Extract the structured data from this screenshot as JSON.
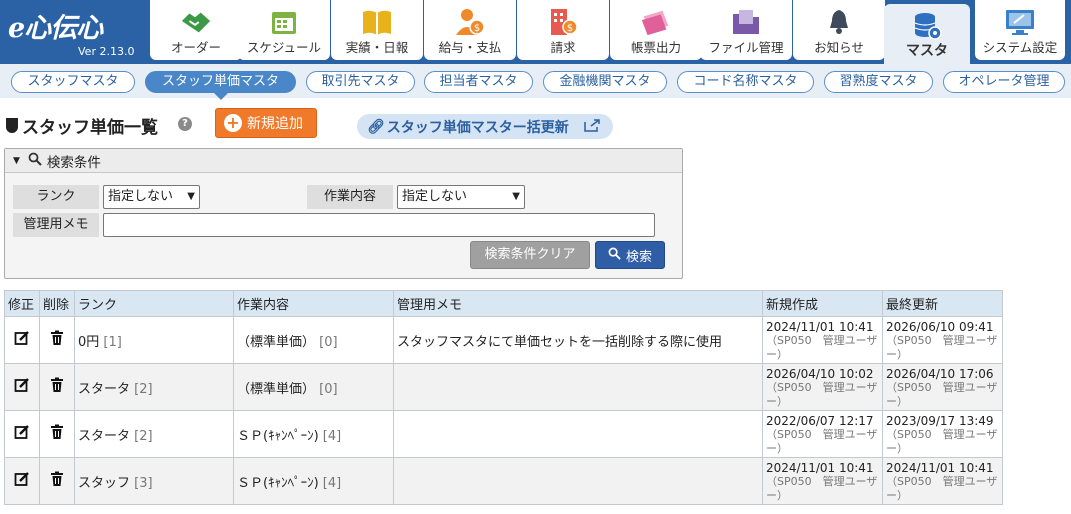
{
  "app": {
    "logo": "e心伝心",
    "version": "Ver 2.13.0"
  },
  "nav": [
    {
      "label": "オーダー",
      "icon": "handshake-icon"
    },
    {
      "label": "スケジュール",
      "icon": "calendar-icon"
    },
    {
      "label": "実績・日報",
      "icon": "book-icon"
    },
    {
      "label": "給与・支払",
      "icon": "person-money-icon"
    },
    {
      "label": "請求",
      "icon": "building-money-icon"
    },
    {
      "label": "帳票出力",
      "icon": "papers-icon"
    },
    {
      "label": "ファイル管理",
      "icon": "folder-icon"
    },
    {
      "label": "お知らせ",
      "icon": "bell-icon"
    },
    {
      "label": "マスタ",
      "icon": "database-gear-icon",
      "active": true
    },
    {
      "label": "システム設定",
      "icon": "monitor-settings-icon"
    }
  ],
  "subtabs": [
    {
      "label": "スタッフマスタ"
    },
    {
      "label": "スタッフ単価マスタ",
      "active": true
    },
    {
      "label": "取引先マスタ"
    },
    {
      "label": "担当者マスタ"
    },
    {
      "label": "金融機関マスタ"
    },
    {
      "label": "コード名称マスタ"
    },
    {
      "label": "習熟度マスタ"
    },
    {
      "label": "オペレータ管理"
    }
  ],
  "page": {
    "title": "スタッフ単価一覧",
    "help": "?",
    "new_button": "新規追加",
    "bulk_update_link": "スタッフ単価マスター括更新"
  },
  "search": {
    "title": "検索条件",
    "rank_label": "ランク",
    "rank_value": "指定しない",
    "work_label": "作業内容",
    "work_value": "指定しない",
    "memo_label": "管理用メモ",
    "memo_value": "",
    "clear_button": "検索条件クリア",
    "search_button": "検索"
  },
  "table": {
    "headers": {
      "edit": "修正",
      "delete": "削除",
      "rank": "ランク",
      "work": "作業内容",
      "memo": "管理用メモ",
      "created": "新規作成",
      "updated": "最終更新"
    },
    "rows": [
      {
        "rank": "0円",
        "rank_code": "[1]",
        "work": "（標準単価）",
        "work_code": "[0]",
        "memo": "スタッフマスタにて単価セットを一括削除する際に使用",
        "created": "2024/11/01 10:41",
        "created_by": "（SP050　管理ユーザー）",
        "updated": "2026/06/10 09:41",
        "updated_by": "（SP050　管理ユーザー）"
      },
      {
        "rank": "スタータ",
        "rank_code": "[2]",
        "work": "（標準単価）",
        "work_code": "[0]",
        "memo": "",
        "created": "2026/04/10 10:02",
        "created_by": "（SP050　管理ユーザー）",
        "updated": "2026/04/10 17:06",
        "updated_by": "（SP050　管理ユーザー）"
      },
      {
        "rank": "スタータ",
        "rank_code": "[2]",
        "work": "ＳＰ(ｷｬﾝﾍﾟｰﾝ)",
        "work_code": "[4]",
        "memo": "",
        "created": "2022/06/07 12:17",
        "created_by": "（SP050　管理ユーザー）",
        "updated": "2023/09/17 13:49",
        "updated_by": "（SP050　管理ユーザー）"
      },
      {
        "rank": "スタッフ",
        "rank_code": "[3]",
        "work": "ＳＰ(ｷｬﾝﾍﾟｰﾝ)",
        "work_code": "[4]",
        "memo": "",
        "created": "2024/11/01 10:41",
        "created_by": "（SP050　管理ユーザー）",
        "updated": "2024/11/01 10:41",
        "updated_by": "（SP050　管理ユーザー）"
      }
    ]
  },
  "colors": {
    "nav_bg": "#2b62a6",
    "accent_orange": "#f07a2a",
    "search_blue": "#2f5ea6"
  }
}
